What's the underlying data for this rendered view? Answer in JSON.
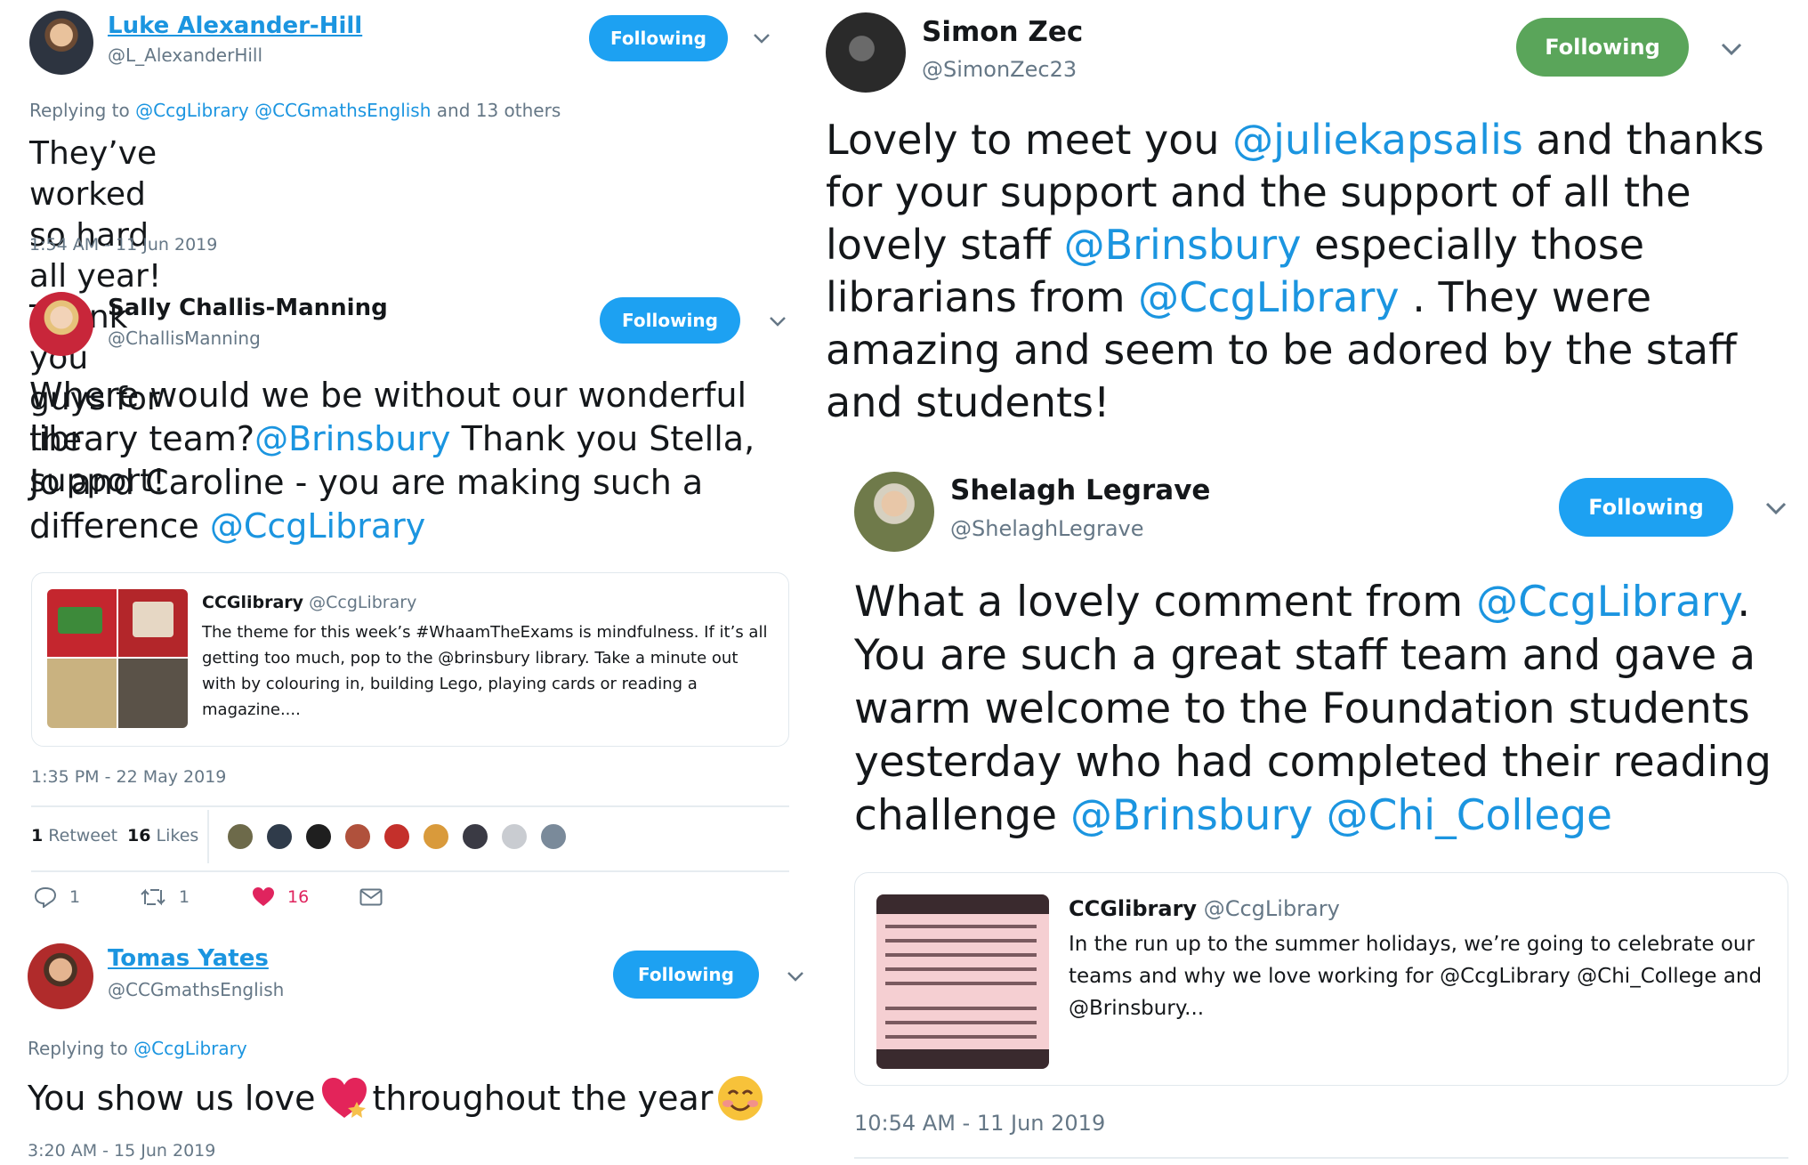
{
  "colors": {
    "link": "#1b95e0",
    "follow_blue": "#1da1f2",
    "follow_green": "#5aa55a",
    "like": "#e0245e",
    "muted": "#657786"
  },
  "tweet1": {
    "name": "Luke Alexander-Hill",
    "handle": "@L_AlexanderHill",
    "follow": "Following",
    "reply_prefix": "Replying to",
    "reply_m1": "@CcgLibrary",
    "reply_m2": "@CCGmathsEnglish",
    "reply_suffix": "and 13 others",
    "text_l1": "They’ve worked so hard all year! Thank you",
    "text_l2": "guys for the support!",
    "time": "1:54 AM - 11 Jun 2019"
  },
  "tweet2": {
    "name": "Sally Challis-Manning",
    "handle": "@ChallisManning",
    "follow": "Following",
    "t_a": "Where would we be without our wonderful library team?",
    "m_a": "@Brinsbury",
    "t_b": "  Thank you Stella, Jo and Caroline - you are making such a difference ",
    "m_b": "@CcgLibrary",
    "quote": {
      "name": "CCGlibrary",
      "handle": "@CcgLibrary",
      "text": "The theme for this week’s #WhaamTheExams is mindfulness. If it’s all getting too much, pop to the @brinsbury library. Take a minute out with by colouring in, building Lego, playing cards or reading a magazine...."
    },
    "time": "1:35 PM - 22 May 2019",
    "retweets": "1",
    "retweets_label": "Retweet",
    "likes": "16",
    "likes_label": "Likes",
    "action_reply": "1",
    "action_retweet": "1",
    "action_like": "16"
  },
  "tweet3": {
    "name": "Tomas Yates",
    "handle": "@CCGmathsEnglish",
    "follow": "Following",
    "reply_prefix": "Replying to",
    "reply_m1": "@CcgLibrary",
    "text_a": "You show us love ",
    "text_b": " throughout the year ",
    "time": "3:20 AM - 15 Jun 2019"
  },
  "tweet4": {
    "name": "Simon Zec",
    "handle": "@SimonZec23",
    "follow": "Following",
    "t1": "Lovely to meet you ",
    "m1": "@juliekapsalis",
    "t2": " and thanks for your support and the support of all the lovely staff ",
    "m2": "@Brinsbury",
    "t3": " especially those librarians from ",
    "m3": "@CcgLibrary",
    "t4": " . They were amazing and seem to be adored by the staff and students!"
  },
  "tweet5": {
    "name": "Shelagh Legrave",
    "handle": "@ShelaghLegrave",
    "follow": "Following",
    "t1": "What a lovely comment from ",
    "m1": "@CcgLibrary",
    "t2": ". You are such a great staff team and gave a warm welcome to the Foundation students yesterday who had completed their reading challenge ",
    "m2": "@Brinsbury",
    "m3": "@Chi_College",
    "quote": {
      "name": "CCGlibrary",
      "handle": "@CcgLibrary",
      "text": "In the run up to the summer holidays, we’re going to celebrate our teams and why we love working for @CcgLibrary @Chi_College and @Brinsbury..."
    },
    "time": "10:54 AM - 11 Jun 2019"
  }
}
